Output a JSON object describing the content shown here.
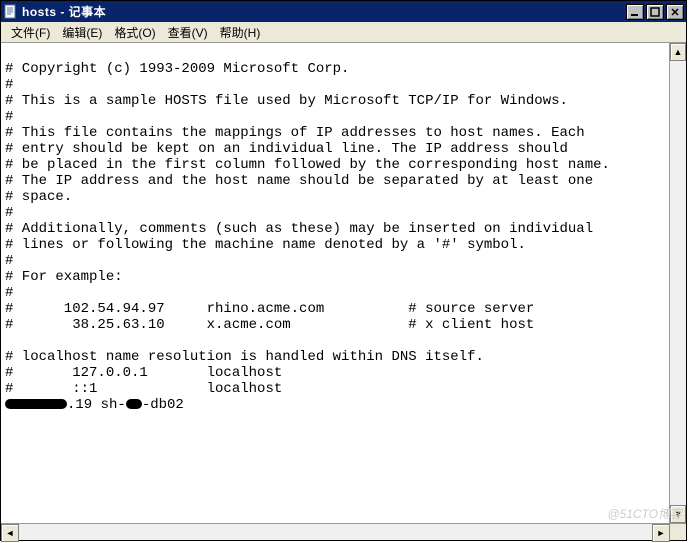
{
  "window": {
    "title": "hosts - 记事本"
  },
  "menu": {
    "file": "文件(F)",
    "edit": "编辑(E)",
    "format": "格式(O)",
    "view": "查看(V)",
    "help": "帮助(H)"
  },
  "content": {
    "l01": "# Copyright (c) 1993-2009 Microsoft Corp.",
    "l02": "#",
    "l03": "# This is a sample HOSTS file used by Microsoft TCP/IP for Windows.",
    "l04": "#",
    "l05": "# This file contains the mappings of IP addresses to host names. Each",
    "l06": "# entry should be kept on an individual line. The IP address should",
    "l07": "# be placed in the first column followed by the corresponding host name.",
    "l08": "# The IP address and the host name should be separated by at least one",
    "l09": "# space.",
    "l10": "#",
    "l11": "# Additionally, comments (such as these) may be inserted on individual",
    "l12": "# lines or following the machine name denoted by a '#' symbol.",
    "l13": "#",
    "l14": "# For example:",
    "l15": "#",
    "l16": "#      102.54.94.97     rhino.acme.com          # source server",
    "l17": "#       38.25.63.10     x.acme.com              # x client host",
    "l18": "",
    "l19": "# localhost name resolution is handled within DNS itself.",
    "l20": "#       127.0.0.1       localhost",
    "l21": "#       ::1             localhost",
    "l22a": ".19 sh-",
    "l22b": "-db02"
  },
  "watermark": "@51CTO博客"
}
